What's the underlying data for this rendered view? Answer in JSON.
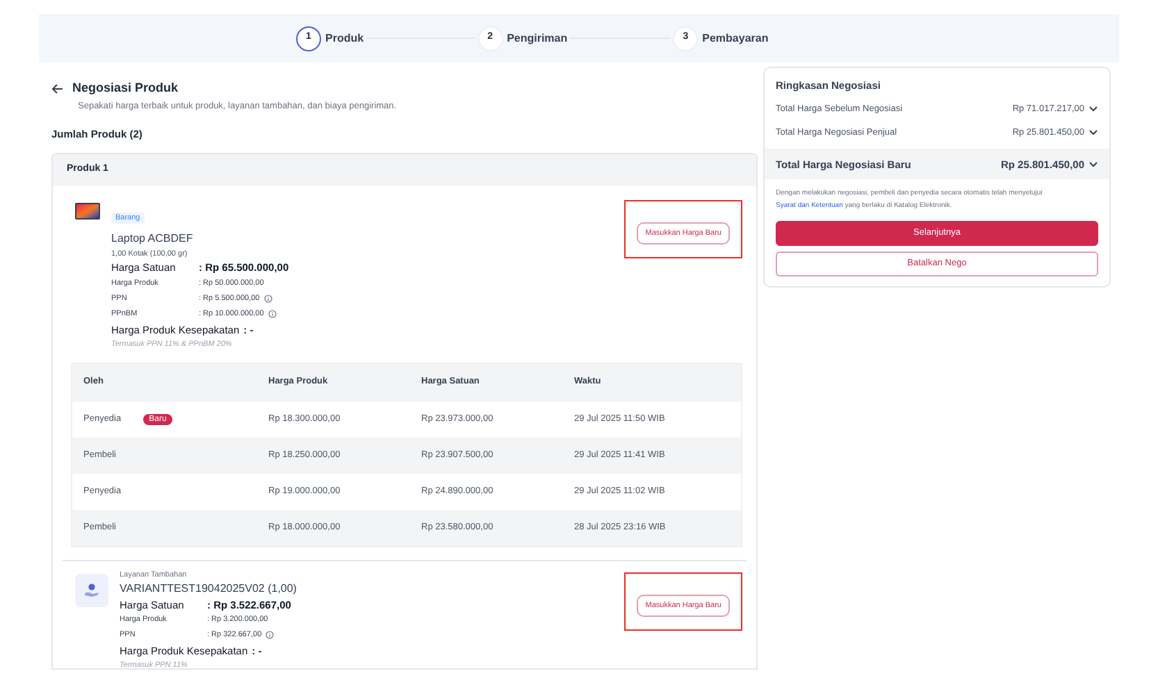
{
  "stepper": [
    {
      "number": "1",
      "label": "Produk",
      "selected": true
    },
    {
      "number": "2",
      "label": "Pengiriman",
      "selected": false
    },
    {
      "number": "3",
      "label": "Pembayaran",
      "selected": false
    }
  ],
  "header": {
    "title": "Negosiasi Produk",
    "subtitle": "Sepakati harga terbaik untuk produk, layanan tambahan, dan biaya pengiriman."
  },
  "product_count": "Jumlah Produk (2)",
  "card": {
    "title": "Produk 1",
    "items": [
      {
        "kind": "goods",
        "tag": "Barang",
        "name": "Laptop ACBDEF",
        "quantity": "1,00 Kotak (100,00 gr)",
        "lines": [
          {
            "label": "Harga Satuan",
            "value": ": Rp 65.500.000,00",
            "main": true,
            "info": false
          },
          {
            "label": "Harga Produk",
            "value": ": Rp 50.000.000,00",
            "main": false,
            "info": false
          },
          {
            "label": "PPN",
            "value": ": Rp 5.500.000,00",
            "main": false,
            "info": true
          },
          {
            "label": "PPnBM",
            "value": ": Rp 10.000.000,00",
            "main": false,
            "info": true
          }
        ],
        "agreed_label": "Harga Produk Kesepakatan",
        "agreed_value": ": -",
        "tax_note": "Termasuk PPN 11% & PPnBM 20%",
        "button": {
          "label": "Masukkan Harga Baru",
          "highlighted": true
        },
        "history": {
          "columns": [
            "Oleh",
            "Harga Produk",
            "Harga Satuan",
            "Waktu"
          ],
          "rows": [
            {
              "by": "Penyedia",
              "badge": "Baru",
              "product_price": "Rp 18.300.000,00",
              "unit_price": "Rp 23.973.000,00",
              "time": "29 Jul 2025 11:50 WIB"
            },
            {
              "by": "Pembeli",
              "product_price": "Rp 18.250.000,00",
              "unit_price": "Rp 23.907.500,00",
              "time": "29 Jul 2025 11:41 WIB"
            },
            {
              "by": "Penyedia",
              "product_price": "Rp 19.000.000,00",
              "unit_price": "Rp 24.890.000,00",
              "time": "29 Jul 2025 11:02 WIB"
            },
            {
              "by": "Pembeli",
              "product_price": "Rp 18.000.000,00",
              "unit_price": "Rp 23.580.000,00",
              "time": "28 Jul 2025 23:16 WIB"
            }
          ]
        }
      },
      {
        "kind": "service",
        "tag": "Layanan Tambahan",
        "name": "VARIANTTEST19042025V02 (1,00)",
        "lines": [
          {
            "label": "Harga Satuan",
            "value": ": Rp 3.522.667,00",
            "main": true,
            "info": false
          },
          {
            "label": "Harga Produk",
            "value": ": Rp 3.200.000,00",
            "main": false,
            "info": false
          },
          {
            "label": "PPN",
            "value": ": Rp 322.667,00",
            "main": false,
            "info": true
          }
        ],
        "agreed_label": "Harga Produk Kesepakatan",
        "agreed_value": ": -",
        "tax_note": "Termasuk PPN 11%",
        "button": {
          "label": "Masukkan Harga Baru",
          "highlighted": true
        }
      }
    ]
  },
  "summary": {
    "title": "Ringkasan Negosiasi",
    "lines": [
      {
        "label": "Total Harga Sebelum Negosiasi",
        "value": "Rp 71.017.217,00",
        "total": false
      },
      {
        "label": "Total Harga Negosiasi Penjual",
        "value": "Rp 25.801.450,00",
        "total": false
      },
      {
        "label": "Total Harga Negosiasi Baru",
        "value": "Rp 25.801.450,00",
        "total": true
      }
    ],
    "note_before": "Dengan melakukan negosiasi, pembeli dan penyedia secara otomatis telah menyetujui",
    "note_link": "Syarat dan Ketentuan",
    "note_after": "yang berlaku di Katalog Elektronik.",
    "buttons": [
      {
        "kind": "primary",
        "label": "Selanjutnya"
      },
      {
        "kind": "secondary",
        "label": "Batalkan Nego"
      }
    ]
  }
}
